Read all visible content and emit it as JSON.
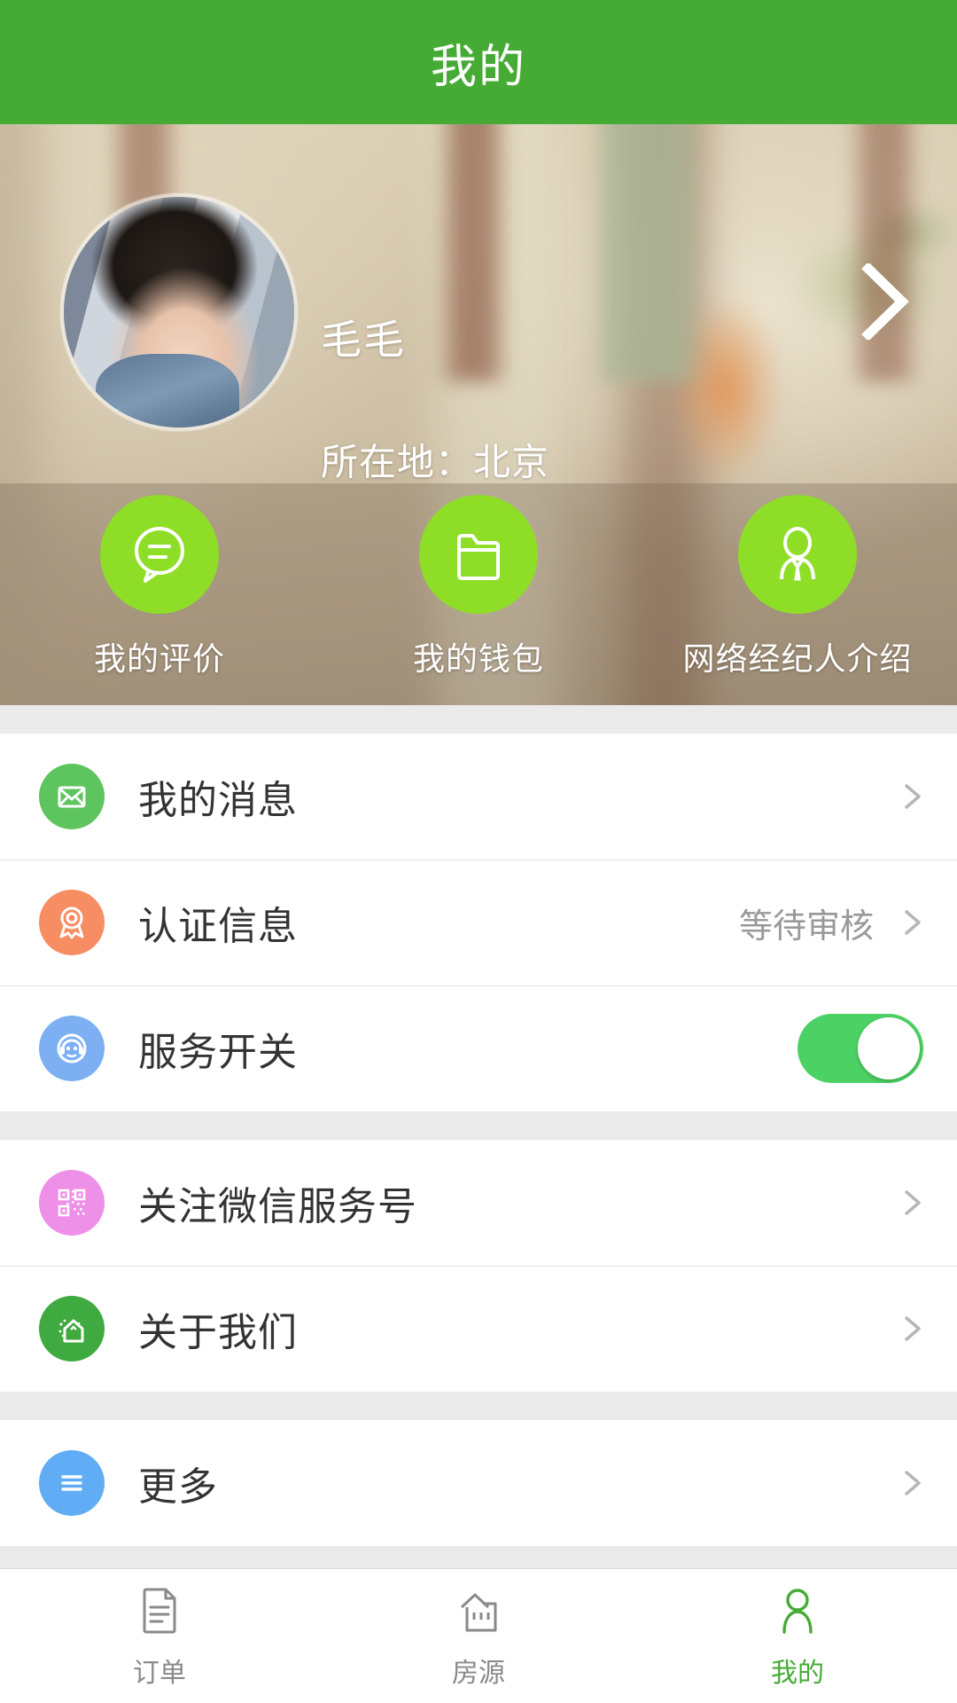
{
  "header": {
    "title": "我的"
  },
  "profile": {
    "name": "毛毛",
    "location_text": "所在地：北京",
    "avatar_name": "user-avatar",
    "arrow_icon": "chevron-right-icon"
  },
  "quick_actions": [
    {
      "label": "我的评价",
      "icon": "chat-bubble-icon",
      "color": "#8ede27"
    },
    {
      "label": "我的钱包",
      "icon": "folder-icon",
      "color": "#8ede27"
    },
    {
      "label": "网络经纪人介绍",
      "icon": "agent-person-icon",
      "color": "#8ede27"
    }
  ],
  "groups": [
    {
      "rows": [
        {
          "label": "我的消息",
          "icon": "envelope-icon",
          "icon_color": "#5ec45e",
          "status": "",
          "control": "chevron"
        },
        {
          "label": "认证信息",
          "icon": "medal-icon",
          "icon_color": "#f78d63",
          "status": "等待审核",
          "control": "chevron"
        },
        {
          "label": "服务开关",
          "icon": "headset-icon",
          "icon_color": "#7cb0f2",
          "status": "",
          "control": "toggle",
          "toggle_on": true
        }
      ]
    },
    {
      "rows": [
        {
          "label": "关注微信服务号",
          "icon": "qrcode-icon",
          "icon_color": "#ee8fe8",
          "status": "",
          "control": "chevron"
        },
        {
          "label": "关于我们",
          "icon": "house-icon",
          "icon_color": "#3faa3f",
          "status": "",
          "control": "chevron"
        }
      ]
    },
    {
      "rows": [
        {
          "label": "更多",
          "icon": "menu-lines-icon",
          "icon_color": "#61adf5",
          "status": "",
          "control": "chevron"
        }
      ]
    }
  ],
  "tabbar": [
    {
      "label": "订单",
      "icon": "document-icon",
      "active": false
    },
    {
      "label": "房源",
      "icon": "building-icon",
      "active": false
    },
    {
      "label": "我的",
      "icon": "person-icon",
      "active": true
    }
  ],
  "colors": {
    "header_green": "#46ab35",
    "accent_green": "#8ede27",
    "toggle_green": "#4cd264",
    "tab_active": "#46ab35"
  }
}
